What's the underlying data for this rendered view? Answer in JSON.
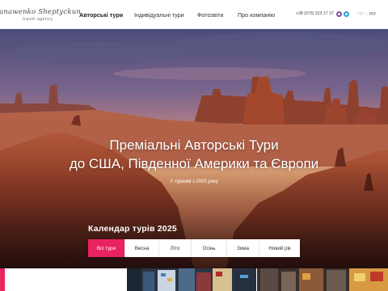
{
  "header": {
    "logo_script": "Yanawenko Sheptyckun",
    "logo_sub": "travel agency",
    "nav": [
      {
        "label": "Авторські тури",
        "active": true
      },
      {
        "label": "Індивідуальні тури",
        "active": false
      },
      {
        "label": "Фотозвіти",
        "active": false
      },
      {
        "label": "Про компанію",
        "active": false
      }
    ],
    "phone": "+38 (073) 313 17 37",
    "social_icons": [
      "viber-icon",
      "telegram-icon"
    ],
    "lang_ua": "укр",
    "lang_sep": "|",
    "lang_ru": "рус"
  },
  "hero": {
    "title_line1": "Преміальні Авторські Тури",
    "title_line2": "до США, Південної Америки та Європи",
    "subtitle": "У туризмі з 2003 року",
    "background": "monument-valley-sunset"
  },
  "calendar": {
    "title": "Календар турів 2025",
    "tabs": [
      {
        "label": "Всі тури",
        "active": true
      },
      {
        "label": "Весна",
        "active": false
      },
      {
        "label": "Літо",
        "active": false
      },
      {
        "label": "Осінь",
        "active": false
      },
      {
        "label": "Зима",
        "active": false
      },
      {
        "label": "Новий рік",
        "active": false
      }
    ]
  },
  "colors": {
    "accent": "#e8235f",
    "sky_top": "#4e4f7a",
    "horizon": "#e89a6c",
    "rock": "#a2452c"
  }
}
